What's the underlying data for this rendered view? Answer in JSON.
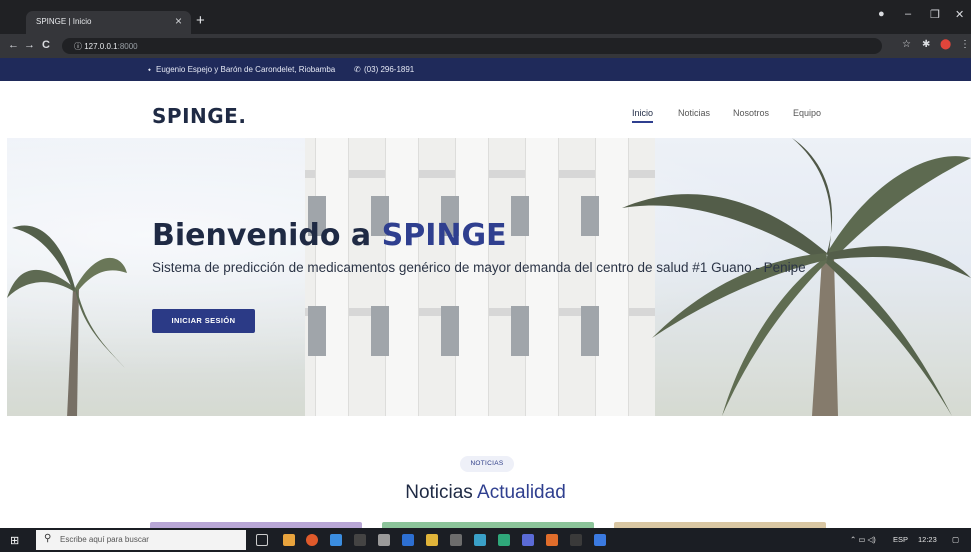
{
  "browser": {
    "tab_title": "SPINGE | Inicio",
    "tab_close": "×",
    "new_tab": "+",
    "back": "←",
    "forward": "→",
    "reload": "C",
    "info": "ⓘ",
    "url_host": "127.0.0.1",
    "url_port": ":8000",
    "star": "☆",
    "window_controls": [
      "–",
      "❐",
      "✕"
    ]
  },
  "infobar": {
    "address": "Eugenio Espejo y Barón de Carondelet, Riobamba",
    "phone": "(03) 296-1891"
  },
  "nav": {
    "logo": "SPINGE.",
    "items": [
      "Inicio",
      "Noticias",
      "Nosotros",
      "Equipo"
    ],
    "active": "Inicio"
  },
  "hero": {
    "title_prefix": "Bienvenido a ",
    "title_accent": "SPINGE",
    "subtitle": "Sistema de predicción de medicamentos genérico de mayor demanda del centro de salud #1 Guano - Penipe",
    "button": "INICIAR SESIÓN"
  },
  "news": {
    "badge": "NOTICIAS",
    "title": "Noticias",
    "title_accent": "Actualidad"
  },
  "taskbar": {
    "search_placeholder": "Escribe aquí para buscar",
    "lang": "ESP",
    "time": "12:23"
  },
  "colors": {
    "brand": "#2f3f8f",
    "infobar": "#1f2a5a",
    "button": "#2b3a86"
  }
}
